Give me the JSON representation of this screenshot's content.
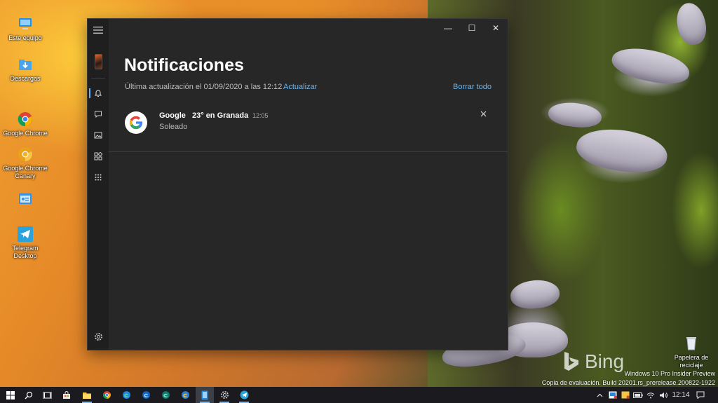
{
  "desktop": {
    "icons": [
      {
        "label": "Este equipo"
      },
      {
        "label": "Descargas"
      },
      {
        "label": "Google Chrome"
      },
      {
        "label": "Google Chrome Canary"
      },
      {
        "label": ""
      },
      {
        "label": "Telegram Desktop"
      }
    ],
    "recycle_bin": {
      "label": "Papelera de reciclaje"
    }
  },
  "window": {
    "title": "Notificaciones",
    "last_updated": "Última actualización el 01/09/2020 a las 12:12",
    "refresh_label": "Actualizar",
    "clear_all_label": "Borrar todo",
    "titlebar": {
      "minimize": "—",
      "maximize": "☐",
      "close": "✕"
    },
    "sidebar_icons": [
      "hamburger-icon",
      "phone-thumbnail",
      "bell-icon",
      "chat-icon",
      "photos-icon",
      "apps-icon",
      "grid-icon",
      "gear-icon"
    ],
    "notifications": [
      {
        "app": "Google",
        "title": "23° en Granada",
        "time": "12:05",
        "body": "Soleado"
      }
    ]
  },
  "watermark": {
    "bing": "Bing",
    "line1": "Windows 10 Pro Insider Preview",
    "line2": "Copia de evaluación. Build 20201.rs_prerelease.200822-1922"
  },
  "taskbar": {
    "clock": "12:14",
    "accent": "#7bb8ef"
  }
}
